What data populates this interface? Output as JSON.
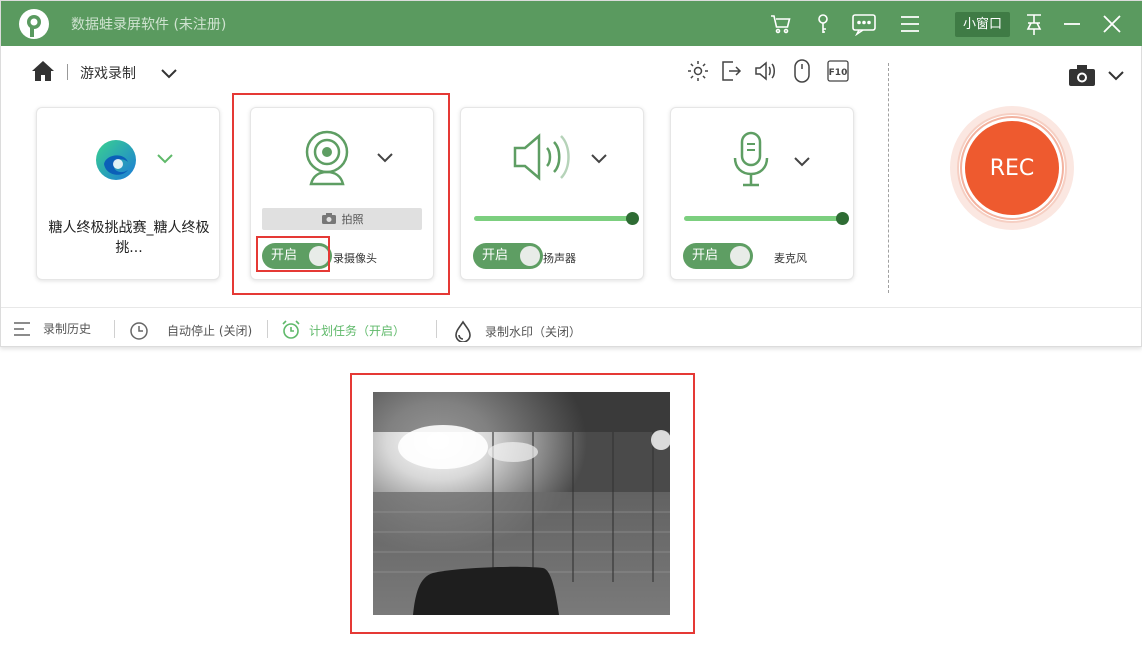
{
  "titlebar": {
    "app_title": "数据蛙录屏软件 (未注册)",
    "mini_window_label": "小窗口",
    "icons": [
      "cart-icon",
      "key-icon",
      "chat-icon",
      "menu-icon",
      "pin-icon",
      "minimize-icon",
      "close-icon"
    ]
  },
  "toolbar": {
    "mode_label": "游戏录制",
    "icons": [
      "settings-icon",
      "export-icon",
      "speaker-icon",
      "mouse-icon",
      "f10-icon"
    ]
  },
  "cards": {
    "game": {
      "label": "糖人终极挑战赛_糖人终极挑..."
    },
    "webcam": {
      "photo_label": "拍照",
      "toggle_label": "开启",
      "caption": "录摄像头"
    },
    "speaker": {
      "toggle_label": "开启",
      "caption": "扬声器",
      "volume_pct": 100
    },
    "mic": {
      "toggle_label": "开启",
      "caption": "麦克风",
      "volume_pct": 100
    }
  },
  "rec": {
    "label": "REC"
  },
  "bottom": {
    "history": "录制历史",
    "auto_stop": "自动停止 (关闭)",
    "schedule": "计划任务（开启）",
    "watermark": "录制水印（关闭）"
  },
  "colors": {
    "titlebar": "#5a9a5f",
    "accent_green": "#5e9e63",
    "slider_green": "#7ccf7f",
    "rec_orange": "#ee5a2f",
    "highlight_red": "#e53935"
  }
}
